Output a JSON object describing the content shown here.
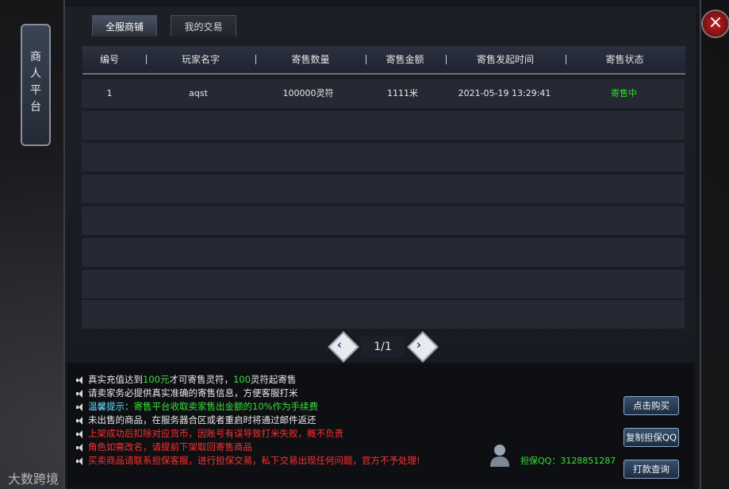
{
  "sidebar": {
    "banner_text": "商人平台"
  },
  "tabs": [
    {
      "label": "全服商铺"
    },
    {
      "label": "我的交易"
    }
  ],
  "table": {
    "headers": [
      "编号",
      "玩家名字",
      "寄售数量",
      "寄售金额",
      "寄售发起时间",
      "寄售状态"
    ],
    "rows": [
      {
        "id": "1",
        "player": "aqst",
        "quantity": "100000灵符",
        "amount": "1111米",
        "time": "2021-05-19 13:29:41",
        "status": "寄售中"
      }
    ]
  },
  "pager": {
    "text": "1/1"
  },
  "notices": [
    {
      "parts": [
        {
          "t": "真实充值达到",
          "c": "white"
        },
        {
          "t": "100元",
          "c": "green"
        },
        {
          "t": "才可寄售灵符，",
          "c": "white"
        },
        {
          "t": "100",
          "c": "green"
        },
        {
          "t": "灵符起寄售",
          "c": "white"
        }
      ]
    },
    {
      "parts": [
        {
          "t": "请卖家务必提供真实准确的寄售信息，方便客服打米",
          "c": "white"
        }
      ]
    },
    {
      "parts": [
        {
          "t": "温馨提示：",
          "c": "cyan"
        },
        {
          "t": "寄售平台收取卖家售出金额的10%作为手续费",
          "c": "green"
        }
      ]
    },
    {
      "parts": [
        {
          "t": "未出售的商品，在服务器合区或者重启时将通过邮件返还",
          "c": "white"
        }
      ]
    },
    {
      "parts": [
        {
          "t": "上架成功后扣除对应货币，因账号有误导致打米失败，概不负责",
          "c": "red"
        }
      ]
    },
    {
      "parts": [
        {
          "t": "角色如需改名，请提前下架取回寄售商品",
          "c": "red"
        }
      ]
    },
    {
      "parts": [
        {
          "t": "买卖商品请联系担保客服，进行担保交易，私下交易出现任何问题，官方不予处理!",
          "c": "red"
        }
      ]
    }
  ],
  "buttons": {
    "buy": "点击购买",
    "copy_qq": "复制担保QQ",
    "query": "打款查询"
  },
  "guarantee_qq": "担保QQ：3128851287",
  "watermark": "大数跨境",
  "colors": {
    "status_active": "#28e028",
    "accent_green": "#38e038",
    "warning_red": "#ff3030"
  }
}
